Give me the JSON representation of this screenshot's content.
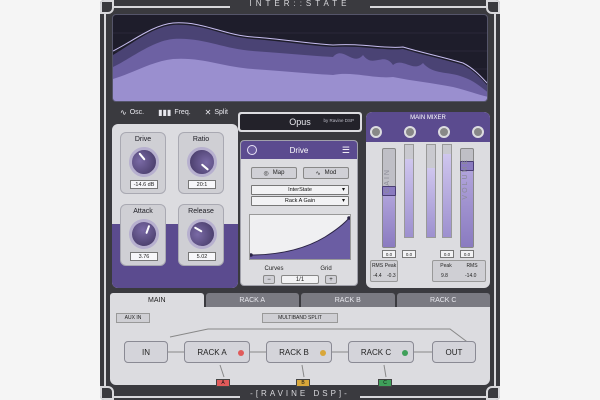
{
  "brand": {
    "top": "INTER::STATE",
    "bottom": "-[RAVINE DSP]-"
  },
  "toolbar": {
    "items": [
      {
        "icon": "wave-icon",
        "label": "Osc."
      },
      {
        "icon": "bars-icon",
        "label": "Freq."
      },
      {
        "icon": "split-icon",
        "label": "Split"
      }
    ]
  },
  "preset": {
    "name": "Opus",
    "by": "by Ravine DSP"
  },
  "knobs": [
    {
      "label": "Drive",
      "value": "-14.6 dB"
    },
    {
      "label": "Ratio",
      "value": "20:1"
    },
    {
      "label": "Attack",
      "value": "3.76"
    },
    {
      "label": "Release",
      "value": "5.02"
    }
  ],
  "drive": {
    "title": "Drive",
    "map_label": "Map",
    "mod_label": "Mod",
    "source": "InterState",
    "target": "Rack A Gain",
    "curves_label": "Curves",
    "grid_label": "Grid",
    "page": "1/1",
    "prev": "−",
    "next": "+"
  },
  "mixer": {
    "title": "MAIN MIXER",
    "gain_label": "GAIN",
    "volume_label": "VOLUME",
    "gain_value": "0.0",
    "volume_value": "0.0",
    "gain_level": 0.58,
    "volume_level": 0.84,
    "meters": [
      0.85,
      0.75,
      0.9,
      0.78
    ],
    "stats": [
      {
        "label": "RMS",
        "left": "-4.4",
        "right": "-0.3"
      },
      {
        "label": "Peak",
        "left": "",
        "right": ""
      },
      {
        "label": "Peak",
        "left": "9.8",
        "right": "-14.0"
      },
      {
        "label": "RMS",
        "left": "",
        "right": ""
      }
    ]
  },
  "tabs": [
    {
      "label": "MAIN",
      "active": true
    },
    {
      "label": "RACK A",
      "active": false
    },
    {
      "label": "RACK B",
      "active": false
    },
    {
      "label": "RACK C",
      "active": false
    }
  ],
  "routing": {
    "aux": "AUX IN",
    "multiband": "MULTIBAND SPLIT",
    "nodes": [
      "IN",
      "RACK A",
      "RACK B",
      "RACK C",
      "OUT"
    ],
    "tags": [
      "A",
      "B",
      "C"
    ]
  },
  "colors": {
    "accent": "#5b4b8f",
    "rackA": "#e05a5a",
    "rackB": "#d9a73a",
    "rackC": "#3fa05a"
  }
}
